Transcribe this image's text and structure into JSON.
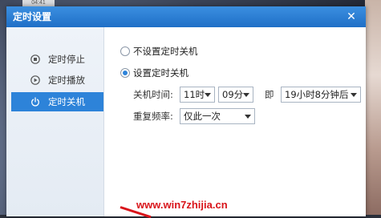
{
  "background": {
    "top_label": "04:41"
  },
  "dialog": {
    "title": "定时设置",
    "close_glyph": "✕",
    "sidebar": {
      "items": [
        {
          "label": "定时停止",
          "icon": "stop-icon",
          "active": false
        },
        {
          "label": "定时播放",
          "icon": "play-icon",
          "active": false
        },
        {
          "label": "定时关机",
          "icon": "power-icon",
          "active": true
        }
      ]
    },
    "options": {
      "no_shutdown_label": "不设置定时关机",
      "set_shutdown_label": "设置定时关机",
      "selected": "set_shutdown"
    },
    "shutdown_time": {
      "label": "关机时间:",
      "hour": "11时",
      "minute": "09分",
      "connector": "即",
      "relative": "19小时8分钟后"
    },
    "repeat": {
      "label": "重复频率:",
      "value": "仅此一次"
    }
  },
  "watermark": {
    "text": "www.win7zhijia.cn"
  },
  "colors": {
    "accent": "#2d83d9",
    "titlebar": "#1f6fc7",
    "watermark": "#d9141a"
  }
}
